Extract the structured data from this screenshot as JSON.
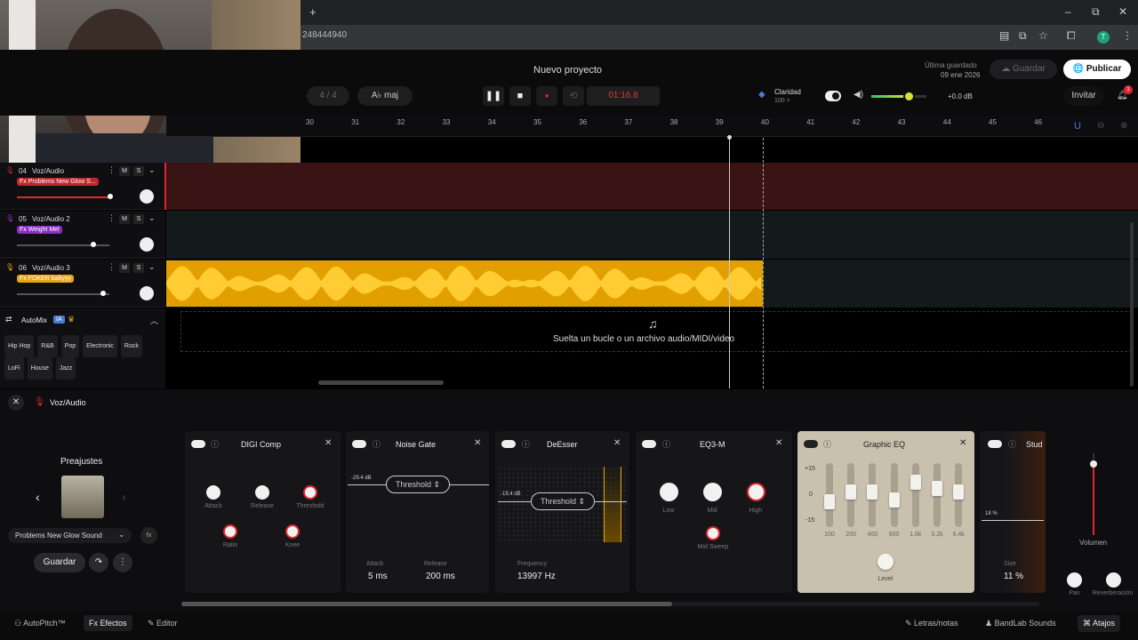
{
  "browser": {
    "url": "248444940",
    "win_min": "–",
    "win_max": "⧉",
    "win_close": "✕",
    "new_tab": "+",
    "profile": "T"
  },
  "header": {
    "project_title": "Nuevo proyecto",
    "last_saved_label": "Última guardado",
    "last_saved_date": "09 ene 2026",
    "save_label": "Guardar",
    "publish_label": "Publicar",
    "invite_label": "Invitar",
    "notif_count": "1",
    "time_sig": "4 / 4",
    "key_label": "A♭ maj",
    "time": "01:16.8",
    "clarity_label": "Claridad",
    "clarity_value": "100 >",
    "volume_db": "+0.0 dB"
  },
  "ruler": [
    "30",
    "31",
    "32",
    "33",
    "34",
    "35",
    "36",
    "37",
    "38",
    "39",
    "40",
    "41",
    "42",
    "43",
    "44",
    "45",
    "46"
  ],
  "tracks": [
    {
      "num": "04",
      "name": "Voz/Audio",
      "fx": "Fx Problems New Glow S...",
      "fx_color": "#c0272d",
      "lane_color": "#3a1315"
    },
    {
      "num": "05",
      "name": "Voz/Audio 2",
      "fx": "Fx Weight Mel",
      "fx_color": "#8a2ec9",
      "lane_color": "#14191a"
    },
    {
      "num": "06",
      "name": "Voz/Audio 3",
      "fx": "Fx FOKER babyyy",
      "fx_color": "#e8a317",
      "lane_color": "#14191a"
    }
  ],
  "track_buttons": {
    "m": "M",
    "s": "S"
  },
  "automix": {
    "label": "AutoMix",
    "ia": "IA",
    "genres": [
      "Hip Hop",
      "R&B",
      "Pop",
      "Electronic",
      "Rock",
      "LoFi",
      "House",
      "Jazz"
    ]
  },
  "drop_hint": "Suelta un bucle o un archivo audio/MIDI/video",
  "fxpanel": {
    "track_name": "Voz/Audio",
    "presets_title": "Preajustes",
    "preset_name": "Problems New Glow Sound",
    "save_label": "Guardar",
    "cards": {
      "digi": {
        "title": "DIGI Comp",
        "attack": "Attack",
        "release": "Release",
        "threshold": "Threshold",
        "ratio": "Ratio",
        "knee": "Knee"
      },
      "gate": {
        "title": "Noise Gate",
        "db": "-29.4 dB",
        "threshold": "Threshold",
        "attack_label": "Attack",
        "attack_val": "5 ms",
        "release_label": "Release",
        "release_val": "200 ms"
      },
      "deesser": {
        "title": "DeEsser",
        "db": "-19.4 dB",
        "threshold": "Threshold",
        "freq_label": "Frequency",
        "freq_val": "13997 Hz"
      },
      "eq3": {
        "title": "EQ3-M",
        "low": "Low",
        "mid": "Mid",
        "high": "High",
        "sweep": "Mid Sweep"
      },
      "geq": {
        "title": "Graphic EQ",
        "scale": [
          "+15",
          "0",
          "-15"
        ],
        "bands": [
          "100",
          "200",
          "400",
          "800",
          "1.6k",
          "3.2k",
          "6.4k"
        ],
        "band_levels": [
          0.42,
          0.6,
          0.6,
          0.45,
          0.78,
          0.66,
          0.6
        ],
        "level": "Level"
      },
      "stud": {
        "title": "Stud",
        "pct": "18 %",
        "size_label": "Size",
        "size_val": "11 %"
      }
    },
    "volumen": "Volumen",
    "pan": "Pan",
    "reverb": "Reverberación"
  },
  "bottom": {
    "autopitch": "AutoPitch™",
    "effects": "Efectos",
    "editor": "Editor",
    "lyrics": "Letras/notas",
    "sounds": "BandLab Sounds",
    "shortcuts": "Atajos"
  }
}
